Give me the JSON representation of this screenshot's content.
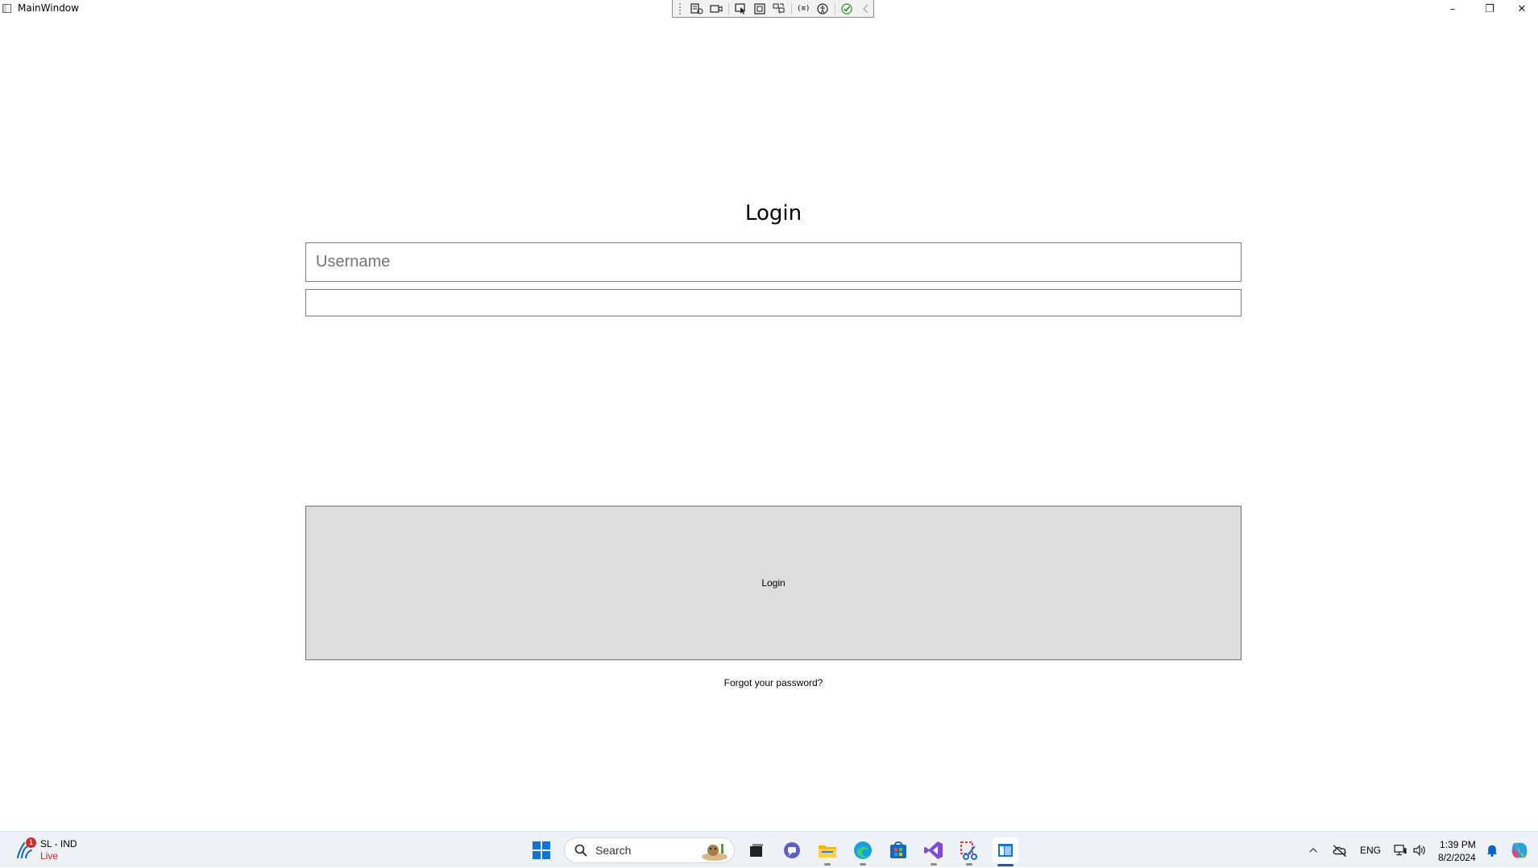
{
  "window": {
    "title": "MainWindow",
    "icon": "app-window-icon",
    "controls": {
      "minimize": "–",
      "restore": "❐",
      "close": "✕"
    }
  },
  "debug_toolbar": {
    "icons": [
      "live-visual-tree-icon",
      "video-icon",
      "select-element-icon",
      "display-layout-adorners-icon",
      "track-focus-icon",
      "binding-failures-icon",
      "accessibility-icon",
      "hot-reload-ok-icon",
      "collapse-chevron-icon"
    ],
    "binding_label": "(≡)"
  },
  "login": {
    "title": "Login",
    "username_placeholder": "Username",
    "username_value": "",
    "password_value": "",
    "button_label": "Login",
    "forgot_link": "Forgot your password?"
  },
  "taskbar": {
    "weather": {
      "badge": "1",
      "title": "SL - IND",
      "status": "Live"
    },
    "search_placeholder": "Search",
    "apps": [
      "windows-start-icon",
      "search-icon",
      "task-view-icon",
      "teams-chat-icon",
      "file-explorer-icon",
      "edge-icon",
      "microsoft-store-icon",
      "visual-studio-icon",
      "snipping-tool-icon",
      "running-app-icon"
    ],
    "tray": {
      "language": "ENG",
      "time": "1:39 PM",
      "date": "8/2/2024"
    }
  },
  "colors": {
    "button_bg": "#dddddd",
    "input_border": "#7a7a7a",
    "taskbar_bg": "#eef1f6",
    "accent": "#005fb8",
    "live_red": "#c42b1c"
  }
}
